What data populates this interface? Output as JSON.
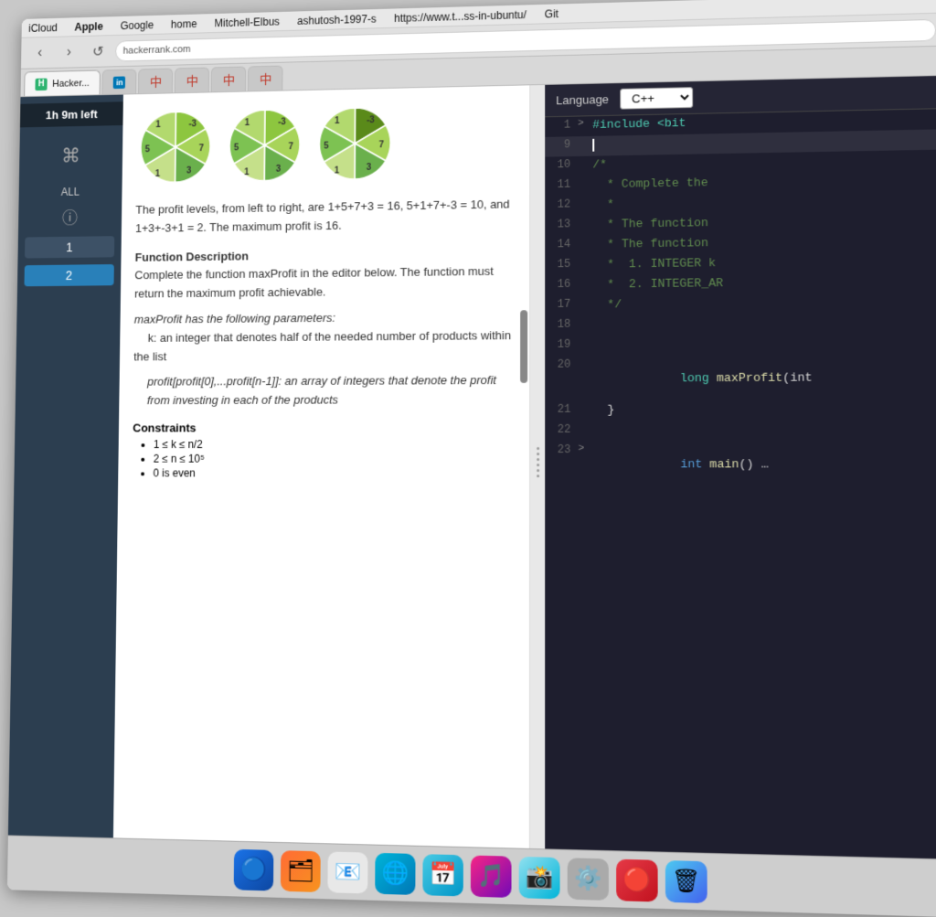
{
  "menubar": {
    "items": [
      "iCloud",
      "Apple",
      "Google",
      "home",
      "Mitchell-Elbus",
      "ashutosh-1997-s",
      "https://www.t...ss-in-ubuntu/",
      "Git"
    ]
  },
  "toolbar": {
    "back_label": "‹",
    "forward_label": "›",
    "reload_label": "↺"
  },
  "tabs": [
    {
      "id": "hacker",
      "label": "Hacker...",
      "icon": "H",
      "active": true
    },
    {
      "id": "linkedin",
      "label": "",
      "icon": "in",
      "active": false
    },
    {
      "id": "tab3",
      "label": "",
      "icon": "中",
      "active": false
    },
    {
      "id": "tab4",
      "label": "",
      "icon": "中",
      "active": false
    },
    {
      "id": "tab5",
      "label": "",
      "icon": "中",
      "active": false
    },
    {
      "id": "tab6",
      "label": "",
      "icon": "中",
      "active": false
    }
  ],
  "sidebar": {
    "timer": "1h 9m left",
    "command_icon": "⌘",
    "all_label": "ALL",
    "info_icon": "ⓘ",
    "items": [
      {
        "num": "1",
        "active": false
      },
      {
        "num": "2",
        "active": true
      }
    ]
  },
  "problem": {
    "description_text": "The profit levels, from left to right, are 1+5+7+3 = 16, 5+1+7+-3 = 10, and 1+3+-3+1 = 2. The maximum profit is 16.",
    "function_desc_title": "Function Description",
    "function_desc_text": "Complete the function maxProfit in the editor below. The function must return the maximum profit achievable.",
    "params_title": "maxProfit has the following parameters:",
    "param_k": "k: an integer that denotes half of the needed number of products within the list",
    "param_profit": "profit[profit[0],...profit[n-1]]: an array of integers that denote the profit from investing in each of the products",
    "constraints_title": "Constraints",
    "constraints": [
      "1 ≤ k ≤ n/2",
      "2 ≤ n ≤ 10⁵",
      "0 is even"
    ],
    "pie_charts": [
      {
        "slices": [
          {
            "label": "-3",
            "color": "#8dc63f",
            "value": 60
          },
          {
            "label": "7",
            "color": "#a8d45a",
            "value": 60
          },
          {
            "label": "3",
            "color": "#6ab04c",
            "value": 60
          },
          {
            "label": "1",
            "color": "#c5e08a",
            "value": 60
          },
          {
            "label": "5",
            "color": "#7dc252",
            "value": 60
          },
          {
            "label": "1",
            "color": "#b2d96e",
            "value": 60
          }
        ]
      },
      {
        "slices": [
          {
            "label": "-3",
            "color": "#8dc63f"
          },
          {
            "label": "7",
            "color": "#a8d45a"
          },
          {
            "label": "3",
            "color": "#6ab04c"
          },
          {
            "label": "1",
            "color": "#c5e08a"
          },
          {
            "label": "5",
            "color": "#7dc252"
          },
          {
            "label": "1",
            "color": "#b2d96e"
          }
        ]
      },
      {
        "slices": [
          {
            "label": "-3",
            "color": "#6aaa30"
          },
          {
            "label": "7",
            "color": "#a8d45a"
          },
          {
            "label": "3",
            "color": "#6ab04c"
          },
          {
            "label": "1",
            "color": "#c5e08a"
          },
          {
            "label": "5",
            "color": "#7dc252"
          },
          {
            "label": "1",
            "color": "#b2d96e"
          }
        ]
      }
    ]
  },
  "code_editor": {
    "language_label": "Language",
    "language_value": "C++",
    "lines": [
      {
        "num": "1",
        "arrow": ">",
        "content": "#include <bit",
        "classes": [
          "kw-green"
        ]
      },
      {
        "num": "9",
        "arrow": "",
        "content": "",
        "cursor": true
      },
      {
        "num": "10",
        "arrow": "",
        "content": "/*",
        "classes": [
          "kw-comment"
        ]
      },
      {
        "num": "11",
        "arrow": "",
        "content": "  * Complete the",
        "classes": [
          "kw-comment"
        ]
      },
      {
        "num": "12",
        "arrow": "",
        "content": "  *",
        "classes": [
          "kw-comment"
        ]
      },
      {
        "num": "13",
        "arrow": "",
        "content": "  * The function",
        "classes": [
          "kw-comment"
        ]
      },
      {
        "num": "14",
        "arrow": "",
        "content": "  * The function",
        "classes": [
          "kw-comment"
        ]
      },
      {
        "num": "15",
        "arrow": "",
        "content": "  *  1. INTEGER k",
        "classes": [
          "kw-comment"
        ]
      },
      {
        "num": "16",
        "arrow": "",
        "content": "  *  2. INTEGER_AR",
        "classes": [
          "kw-comment"
        ]
      },
      {
        "num": "17",
        "arrow": "",
        "content": "  */",
        "classes": [
          "kw-comment"
        ]
      },
      {
        "num": "18",
        "arrow": "",
        "content": "",
        "classes": []
      },
      {
        "num": "19",
        "arrow": "",
        "content": "",
        "classes": []
      },
      {
        "num": "20",
        "arrow": "",
        "content": "long maxProfit(int",
        "classes": [
          "kw-yellow"
        ]
      },
      {
        "num": "21",
        "arrow": "",
        "content": "  }",
        "classes": [
          "kw-white"
        ]
      },
      {
        "num": "22",
        "arrow": "",
        "content": "",
        "classes": []
      },
      {
        "num": "23",
        "arrow": ">",
        "content": "int main() …",
        "classes": [
          "kw-blue"
        ]
      }
    ]
  },
  "dock": {
    "icons": [
      "🔵",
      "📁",
      "📧",
      "🌐",
      "📅",
      "🎵",
      "📸",
      "⚙️"
    ]
  }
}
